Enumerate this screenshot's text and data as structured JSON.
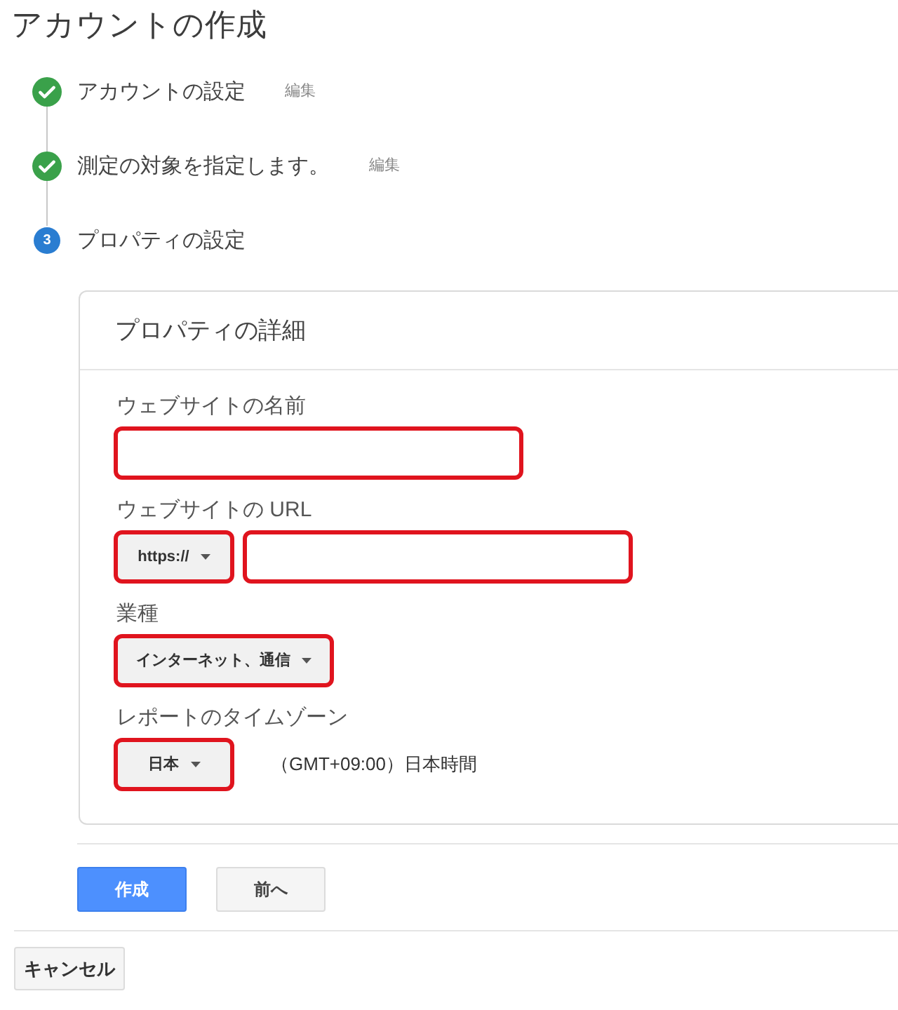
{
  "page": {
    "title": "アカウントの作成"
  },
  "steps": [
    {
      "label": "アカウントの設定",
      "completed": true,
      "edit_link": "編集"
    },
    {
      "label": "測定の対象を指定します。",
      "completed": true,
      "edit_link": "編集"
    },
    {
      "label": "プロパティの設定",
      "completed": false,
      "number": "3"
    }
  ],
  "card": {
    "title": "プロパティの詳細",
    "fields": [
      {
        "label": "ウェブサイトの名前",
        "controls": [
          {
            "kind": "input",
            "highlighted": true
          }
        ]
      },
      {
        "label": "ウェブサイトの URL",
        "controls": [
          {
            "kind": "dropdown",
            "value": "https://",
            "highlighted": true
          },
          {
            "kind": "input",
            "highlighted": true
          }
        ]
      },
      {
        "label": "業種",
        "controls": [
          {
            "kind": "dropdown",
            "value": "インターネット、通信",
            "highlighted": true
          }
        ]
      },
      {
        "label": "レポートのタイムゾーン",
        "controls": [
          {
            "kind": "dropdown",
            "value": "日本",
            "highlighted": true
          },
          {
            "kind": "note",
            "text": "（GMT+09:00）日本時間"
          }
        ]
      }
    ]
  },
  "buttons": [
    {
      "label": "作成",
      "kind": "primary"
    },
    {
      "label": "前へ",
      "kind": "secondary"
    }
  ],
  "cancel_button": {
    "label": "キャンセル"
  }
}
